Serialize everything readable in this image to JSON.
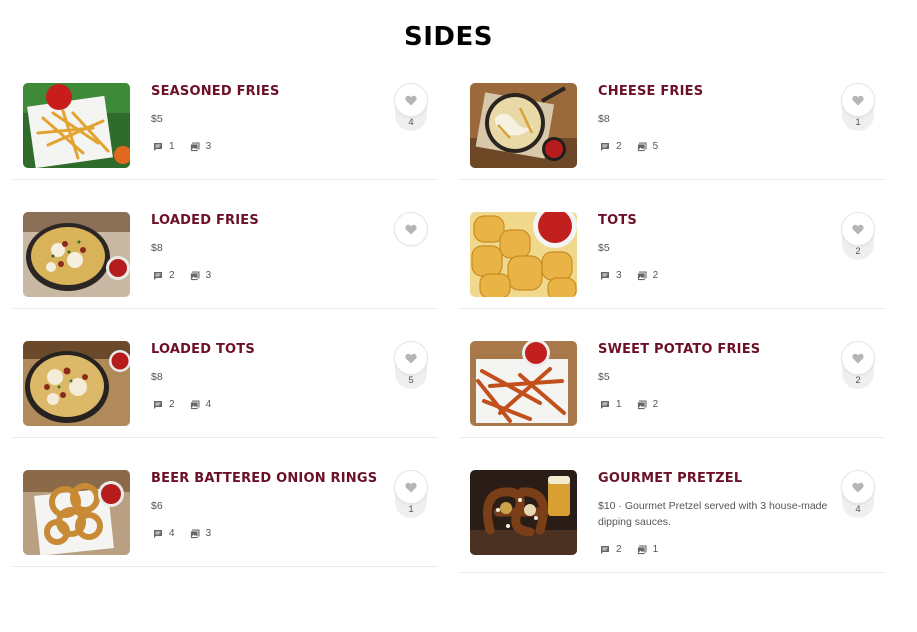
{
  "page": {
    "title": "SIDES"
  },
  "items": [
    {
      "name": "SEASONED FRIES",
      "price": "$5",
      "comments": "1",
      "photos": "3",
      "likes": "4"
    },
    {
      "name": "CHEESE FRIES",
      "price": "$8",
      "comments": "2",
      "photos": "5",
      "likes": "1"
    },
    {
      "name": "LOADED FRIES",
      "price": "$8",
      "comments": "2",
      "photos": "3",
      "likes": ""
    },
    {
      "name": "TOTS",
      "price": "$5",
      "comments": "3",
      "photos": "2",
      "likes": "2"
    },
    {
      "name": "LOADED TOTS",
      "price": "$8",
      "comments": "2",
      "photos": "4",
      "likes": "5"
    },
    {
      "name": "SWEET POTATO FRIES",
      "price": "$5",
      "comments": "1",
      "photos": "2",
      "likes": "2"
    },
    {
      "name": "BEER BATTERED ONION RINGS",
      "price": "$6",
      "comments": "4",
      "photos": "3",
      "likes": "1"
    },
    {
      "name": "GOURMET PRETZEL",
      "price": "$10 · Gourmet Pretzel served with 3 house-made dipping sauces.",
      "comments": "2",
      "photos": "1",
      "likes": "4"
    }
  ],
  "icons": {
    "like": "heart-icon",
    "comments": "comment-icon",
    "photos": "photo-icon"
  },
  "colors": {
    "item_name": "#6b1027",
    "heart": "#b5b5b5",
    "title": "#000000"
  }
}
